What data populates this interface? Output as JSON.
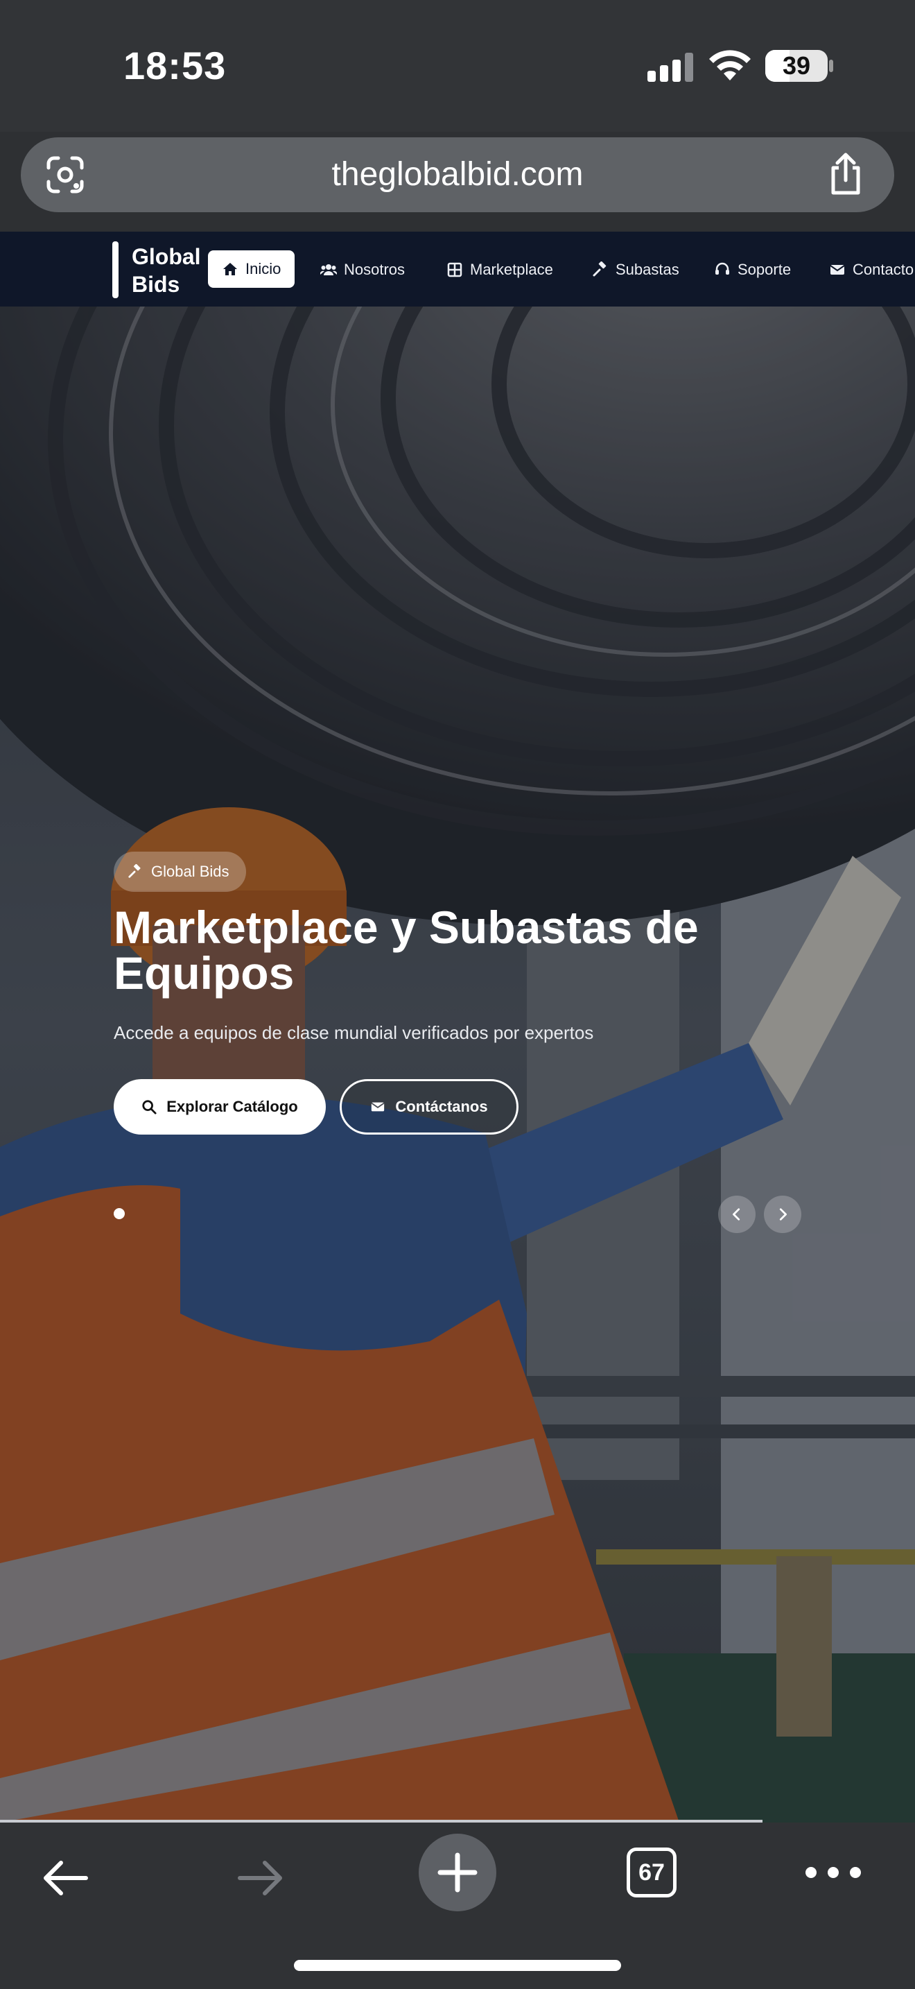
{
  "status_bar": {
    "time": "18:53",
    "battery": "39",
    "icons": [
      "signal-icon",
      "wifi-icon",
      "battery-icon"
    ]
  },
  "browser": {
    "url": "theglobalbid.com",
    "icons": [
      "google-lens-icon",
      "share-icon"
    ]
  },
  "site": {
    "brand_line1": "Global",
    "brand_line2": "Bids",
    "nav": [
      {
        "label": "Inicio",
        "icon": "home-icon",
        "active": true
      },
      {
        "label": "Nosotros",
        "icon": "users-icon"
      },
      {
        "label": "Marketplace",
        "icon": "grid-icon"
      },
      {
        "label": "Subastas",
        "icon": "gavel-icon"
      },
      {
        "label": "Soporte",
        "icon": "headset-icon"
      },
      {
        "label": "Contacto",
        "icon": "envelope-icon"
      }
    ]
  },
  "hero": {
    "badge": "Global Bids",
    "title": "Marketplace y Subastas de Equipos",
    "subtitle": "Accede a equipos de clase mundial verificados por expertos",
    "primary_button": "Explorar Catálogo",
    "secondary_button": "Contáctanos",
    "slide_count": 1,
    "active_slide": 1
  },
  "toolbar": {
    "tab_count": "67",
    "icons": [
      "back-arrow-icon",
      "forward-arrow-icon",
      "new-tab-plus-icon",
      "tabs-icon",
      "more-menu-icon"
    ]
  },
  "colors": {
    "nav_background": "#0f1729",
    "browser_chrome": "#303235",
    "url_bar": "#5f6266"
  }
}
